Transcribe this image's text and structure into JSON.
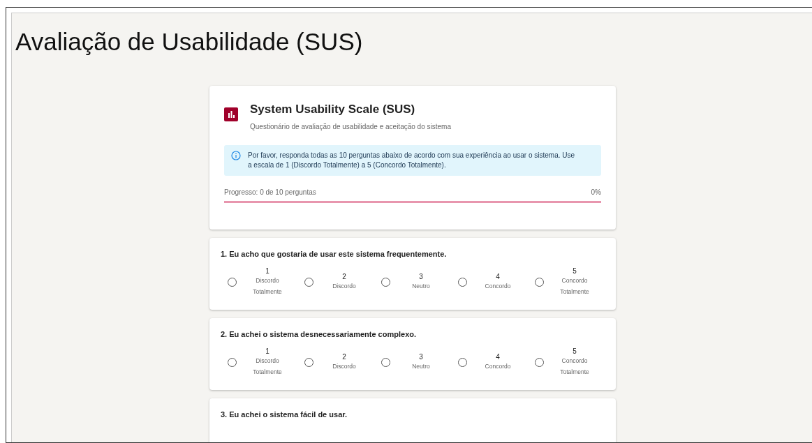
{
  "page_title": "Avaliação de Usabilidade (SUS)",
  "header": {
    "title": "System Usability Scale (SUS)",
    "subtitle": "Questionário de avaliação de usabilidade e aceitação do sistema",
    "info": "Por favor, responda todas as 10 perguntas abaixo de acordo com sua experiência ao usar o sistema. Use a escala de 1 (Discordo Totalmente) a 5 (Concordo Totalmente).",
    "progress_label": "Progresso: 0 de 10 perguntas",
    "progress_percent": "0%",
    "level": 0
  },
  "questions": [
    {
      "text": "1. Eu acho que gostaria de usar este sistema frequentemente.",
      "options": [
        {
          "value": "1",
          "label": "Discordo Totalmente",
          "selected": false
        },
        {
          "value": "2",
          "label": "Discordo",
          "selected": false
        },
        {
          "value": "3",
          "label": "Neutro",
          "selected": false
        },
        {
          "value": "4",
          "label": "Concordo",
          "selected": false
        },
        {
          "value": "5",
          "label": "Concordo Totalmente",
          "selected": false
        }
      ]
    },
    {
      "text": "2. Eu achei o sistema desnecessariamente complexo.",
      "options": [
        {
          "value": "1",
          "label": "Discordo Totalmente",
          "selected": false
        },
        {
          "value": "2",
          "label": "Discordo",
          "selected": false
        },
        {
          "value": "3",
          "label": "Neutro",
          "selected": false
        },
        {
          "value": "4",
          "label": "Concordo",
          "selected": false
        },
        {
          "value": "5",
          "label": "Concordo Totalmente",
          "selected": false
        }
      ]
    },
    {
      "text": "3. Eu achei o sistema fácil de usar."
    }
  ]
}
